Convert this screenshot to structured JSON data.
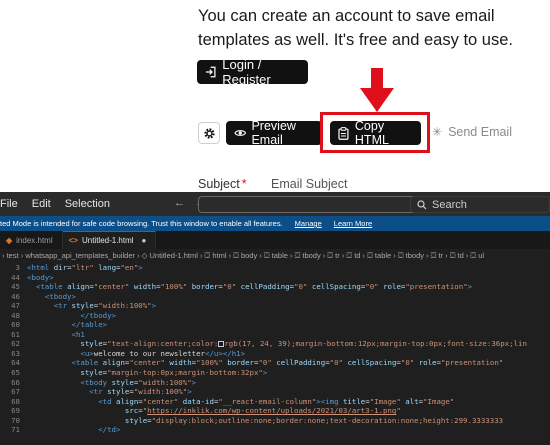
{
  "web": {
    "intro_text": "You can create an account to save email templates as well. It's free and easy to use.",
    "login_button": "Login / Register",
    "preview_button": "Preview Email",
    "copy_button": "Copy HTML",
    "send_email": "Send Email",
    "subject_label": "Subject",
    "subject_required": "*",
    "subject_placeholder": "Email Subject",
    "highlight_color": "#e0101a"
  },
  "editor": {
    "menu": [
      "File",
      "Edit",
      "Selection"
    ],
    "search_label": "Search",
    "restricted_text": "ted Mode is intended for safe code browsing. Trust this window to enable all features.",
    "restricted_manage": "Manage",
    "restricted_learn": "Learn More",
    "tabs": [
      {
        "label": "index.html",
        "active": false
      },
      {
        "label": "Untitled-1.html",
        "active": true,
        "modified": "●"
      }
    ],
    "tab_icon": "<>",
    "breadcrumb": "› test › whatsapp_api_templates_builder › ◇ Untitled-1.html › ⛋ html › ⛋ body › ⛋ table › ⛋ tbody › ⛋ tr › ⛋ td › ⛋ table › ⛋ tbody › ⛋ tr › ⛋ td › ⛋ ul",
    "code_lines": [
      {
        "n": "3",
        "ind": 0,
        "parts": [
          [
            "tag",
            "<html "
          ],
          [
            "attr",
            "dir"
          ],
          [
            "txt",
            "="
          ],
          [
            "str",
            "\"ltr\""
          ],
          [
            "txt",
            " "
          ],
          [
            "attr",
            "lang"
          ],
          [
            "txt",
            "="
          ],
          [
            "str",
            "\"en\""
          ],
          [
            "tag",
            ">"
          ]
        ]
      },
      {
        "n": "44",
        "ind": 0,
        "parts": [
          [
            "tag",
            "<body>"
          ]
        ]
      },
      {
        "n": "45",
        "ind": 2,
        "parts": [
          [
            "tag",
            "<table "
          ],
          [
            "attr",
            "align"
          ],
          [
            "txt",
            "="
          ],
          [
            "str",
            "\"center\""
          ],
          [
            "txt",
            " "
          ],
          [
            "attr",
            "width"
          ],
          [
            "txt",
            "="
          ],
          [
            "str",
            "\"100%\""
          ],
          [
            "txt",
            " "
          ],
          [
            "attr",
            "border"
          ],
          [
            "txt",
            "="
          ],
          [
            "str",
            "\"0\""
          ],
          [
            "txt",
            " "
          ],
          [
            "attr",
            "cellPadding"
          ],
          [
            "txt",
            "="
          ],
          [
            "str",
            "\"0\""
          ],
          [
            "txt",
            " "
          ],
          [
            "attr",
            "cellSpacing"
          ],
          [
            "txt",
            "="
          ],
          [
            "str",
            "\"0\""
          ],
          [
            "txt",
            " "
          ],
          [
            "attr",
            "role"
          ],
          [
            "txt",
            "="
          ],
          [
            "str",
            "\"presentation\""
          ],
          [
            "tag",
            ">"
          ]
        ]
      },
      {
        "n": "46",
        "ind": 4,
        "parts": [
          [
            "tag",
            "<tbody>"
          ]
        ]
      },
      {
        "n": "47",
        "ind": 6,
        "parts": [
          [
            "tag",
            "<tr "
          ],
          [
            "attr",
            "style"
          ],
          [
            "txt",
            "="
          ],
          [
            "str",
            "\"width:100%\""
          ],
          [
            "tag",
            ">"
          ]
        ]
      },
      {
        "n": "48",
        "ind": 12,
        "parts": [
          [
            "tag",
            "</tbody>"
          ]
        ]
      },
      {
        "n": "60",
        "ind": 10,
        "parts": [
          [
            "tag",
            "</table>"
          ]
        ]
      },
      {
        "n": "61",
        "ind": 10,
        "parts": [
          [
            "tag",
            "<h1"
          ]
        ]
      },
      {
        "n": "62",
        "ind": 12,
        "parts": [
          [
            "attr",
            "style"
          ],
          [
            "txt",
            "="
          ],
          [
            "str",
            "\"text-align:center;color:"
          ],
          [
            "swatch",
            ""
          ],
          [
            "str",
            "rgb(17, 24, 39);margin-bottom:12px;margin-top:0px;font-size:36px;lin"
          ]
        ]
      },
      {
        "n": "63",
        "ind": 12,
        "parts": [
          [
            "tag",
            "<u>"
          ],
          [
            "txt",
            "welcome to our newsletter"
          ],
          [
            "tag",
            "</u></h1>"
          ]
        ]
      },
      {
        "n": "64",
        "ind": 10,
        "parts": [
          [
            "tag",
            "<table "
          ],
          [
            "attr",
            "align"
          ],
          [
            "txt",
            "="
          ],
          [
            "str",
            "\"center\""
          ],
          [
            "txt",
            " "
          ],
          [
            "attr",
            "width"
          ],
          [
            "txt",
            "="
          ],
          [
            "str",
            "\"100%\""
          ],
          [
            "txt",
            " "
          ],
          [
            "attr",
            "border"
          ],
          [
            "txt",
            "="
          ],
          [
            "str",
            "\"0\""
          ],
          [
            "txt",
            " "
          ],
          [
            "attr",
            "cellPadding"
          ],
          [
            "txt",
            "="
          ],
          [
            "str",
            "\"0\""
          ],
          [
            "txt",
            " "
          ],
          [
            "attr",
            "cellSpacing"
          ],
          [
            "txt",
            "="
          ],
          [
            "str",
            "\"0\""
          ],
          [
            "txt",
            " "
          ],
          [
            "attr",
            "role"
          ],
          [
            "txt",
            "="
          ],
          [
            "str",
            "\"presentation\""
          ]
        ]
      },
      {
        "n": "65",
        "ind": 12,
        "parts": [
          [
            "attr",
            "style"
          ],
          [
            "txt",
            "="
          ],
          [
            "str",
            "\"margin-top:0px;margin-bottom:32px\""
          ],
          [
            "tag",
            ">"
          ]
        ]
      },
      {
        "n": "66",
        "ind": 12,
        "parts": [
          [
            "tag",
            "<tbody "
          ],
          [
            "attr",
            "style"
          ],
          [
            "txt",
            "="
          ],
          [
            "str",
            "\"width:100%\""
          ],
          [
            "tag",
            ">"
          ]
        ]
      },
      {
        "n": "67",
        "ind": 14,
        "parts": [
          [
            "tag",
            "<tr "
          ],
          [
            "attr",
            "style"
          ],
          [
            "txt",
            "="
          ],
          [
            "str",
            "\"width:100%\""
          ],
          [
            "tag",
            ">"
          ]
        ]
      },
      {
        "n": "68",
        "ind": 16,
        "parts": [
          [
            "tag",
            "<td "
          ],
          [
            "attr",
            "align"
          ],
          [
            "txt",
            "="
          ],
          [
            "str",
            "\"center\""
          ],
          [
            "txt",
            " "
          ],
          [
            "attr",
            "data-id"
          ],
          [
            "txt",
            "="
          ],
          [
            "str",
            "\"__react-email-column\""
          ],
          [
            "tag",
            "><img "
          ],
          [
            "attr",
            "title"
          ],
          [
            "txt",
            "="
          ],
          [
            "str",
            "\"Image\""
          ],
          [
            "txt",
            " "
          ],
          [
            "attr",
            "alt"
          ],
          [
            "txt",
            "="
          ],
          [
            "str",
            "\"Image\""
          ]
        ]
      },
      {
        "n": "69",
        "ind": 22,
        "parts": [
          [
            "attr",
            "src"
          ],
          [
            "txt",
            "="
          ],
          [
            "str",
            "\""
          ],
          [
            "lnk",
            "https://inklik.com/wp-content/uploads/2021/03/art3-1.png"
          ],
          [
            "str",
            "\""
          ]
        ]
      },
      {
        "n": "70",
        "ind": 22,
        "parts": [
          [
            "attr",
            "style"
          ],
          [
            "txt",
            "="
          ],
          [
            "str",
            "\"display:block;outline:none;border:none;text-decoration:none;height:299.3333333"
          ]
        ]
      },
      {
        "n": "71",
        "ind": 16,
        "parts": [
          [
            "tag",
            "</td>"
          ]
        ]
      }
    ]
  }
}
